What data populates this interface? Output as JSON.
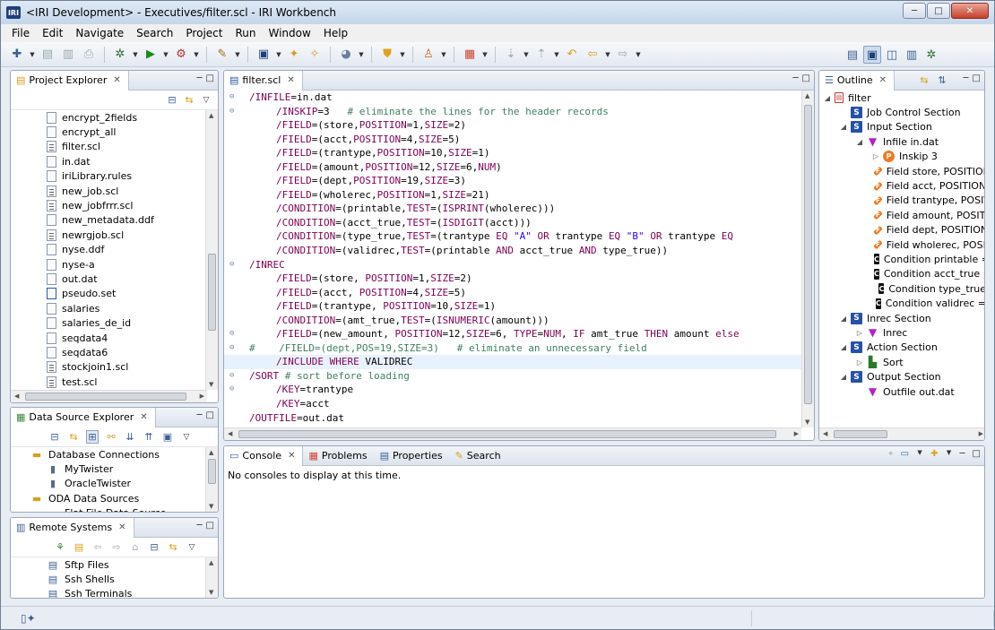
{
  "window": {
    "title": "<IRI Development> - Executives/filter.scl - IRI Workbench",
    "app_icon_text": "IRI",
    "buttons": [
      "─",
      "□",
      "✕"
    ]
  },
  "menu": [
    "File",
    "Edit",
    "Navigate",
    "Search",
    "Project",
    "Run",
    "Window",
    "Help"
  ],
  "project_explorer": {
    "title": "Project Explorer",
    "files": [
      {
        "name": "encrypt_2fields",
        "icon": "file-icon"
      },
      {
        "name": "encrypt_all",
        "icon": "file-icon"
      },
      {
        "name": "filter.scl",
        "icon": "scl-file-icon"
      },
      {
        "name": "in.dat",
        "icon": "file-icon"
      },
      {
        "name": "iriLibrary.rules",
        "icon": "file-icon"
      },
      {
        "name": "new_job.scl",
        "icon": "scl-file-icon"
      },
      {
        "name": "new_jobfrrr.scl",
        "icon": "scl-file-icon"
      },
      {
        "name": "new_metadata.ddf",
        "icon": "ddf-file-icon"
      },
      {
        "name": "newrgjob.scl",
        "icon": "scl-file-icon"
      },
      {
        "name": "nyse.ddf",
        "icon": "ddf-file-icon"
      },
      {
        "name": "nyse-a",
        "icon": "file-icon"
      },
      {
        "name": "out.dat",
        "icon": "file-icon"
      },
      {
        "name": "pseudo.set",
        "icon": "set-file-icon"
      },
      {
        "name": "salaries",
        "icon": "file-icon"
      },
      {
        "name": "salaries_de_id",
        "icon": "file-icon"
      },
      {
        "name": "seqdata4",
        "icon": "file-icon"
      },
      {
        "name": "seqdata6",
        "icon": "file-icon"
      },
      {
        "name": "stockjoin1.scl",
        "icon": "scl-file-icon"
      },
      {
        "name": "test.scl",
        "icon": "scl-file-icon"
      }
    ]
  },
  "data_source_explorer": {
    "title": "Data Source Explorer",
    "items": [
      {
        "label": "Database Connections",
        "level": 0,
        "icon": "folder-icon"
      },
      {
        "label": "MyTwister",
        "level": 1,
        "icon": "database-icon"
      },
      {
        "label": "OracleTwister",
        "level": 1,
        "icon": "database-icon"
      },
      {
        "label": "ODA Data Sources",
        "level": 0,
        "icon": "folder-icon"
      },
      {
        "label": "Flat File Data Source",
        "level": 1,
        "icon": "folder-icon"
      }
    ]
  },
  "remote_systems": {
    "title": "Remote Systems",
    "items": [
      {
        "label": "Sftp Files",
        "icon": "sftp-icon"
      },
      {
        "label": "Ssh Shells",
        "icon": "shell-icon"
      },
      {
        "label": "Ssh Terminals",
        "icon": "terminal-icon"
      }
    ]
  },
  "editor": {
    "tab": "filter.scl",
    "lines": [
      {
        "fold": "⊖",
        "indent": 0,
        "parts": [
          [
            "k",
            "/INFILE"
          ],
          [
            "v",
            "=in.dat"
          ]
        ]
      },
      {
        "fold": "⊖",
        "indent": 1,
        "parts": [
          [
            "k",
            "/INSKIP"
          ],
          [
            "v",
            "=3   "
          ],
          [
            "c",
            "# eliminate the lines for the header records"
          ]
        ]
      },
      {
        "fold": "",
        "indent": 1,
        "parts": [
          [
            "k",
            "/FIELD"
          ],
          [
            "v",
            "=(store,"
          ],
          [
            "n",
            "POSITION"
          ],
          [
            "v",
            "=1,"
          ],
          [
            "n",
            "SIZE"
          ],
          [
            "v",
            "=2)"
          ]
        ]
      },
      {
        "fold": "",
        "indent": 1,
        "parts": [
          [
            "k",
            "/FIELD"
          ],
          [
            "v",
            "=(acct,"
          ],
          [
            "n",
            "POSITION"
          ],
          [
            "v",
            "=4,"
          ],
          [
            "n",
            "SIZE"
          ],
          [
            "v",
            "=5)"
          ]
        ]
      },
      {
        "fold": "",
        "indent": 1,
        "parts": [
          [
            "k",
            "/FIELD"
          ],
          [
            "v",
            "=(trantype,"
          ],
          [
            "n",
            "POSITION"
          ],
          [
            "v",
            "=10,"
          ],
          [
            "n",
            "SIZE"
          ],
          [
            "v",
            "=1)"
          ]
        ]
      },
      {
        "fold": "",
        "indent": 1,
        "parts": [
          [
            "k",
            "/FIELD"
          ],
          [
            "v",
            "=(amount,"
          ],
          [
            "n",
            "POSITION"
          ],
          [
            "v",
            "=12,"
          ],
          [
            "n",
            "SIZE"
          ],
          [
            "v",
            "=6,"
          ],
          [
            "n",
            "NUM"
          ],
          [
            "v",
            ")"
          ]
        ]
      },
      {
        "fold": "",
        "indent": 1,
        "parts": [
          [
            "k",
            "/FIELD"
          ],
          [
            "v",
            "=(dept,"
          ],
          [
            "n",
            "POSITION"
          ],
          [
            "v",
            "=19,"
          ],
          [
            "n",
            "SIZE"
          ],
          [
            "v",
            "=3)"
          ]
        ]
      },
      {
        "fold": "",
        "indent": 1,
        "parts": [
          [
            "k",
            "/FIELD"
          ],
          [
            "v",
            "=(wholerec,"
          ],
          [
            "n",
            "POSITION"
          ],
          [
            "v",
            "=1,"
          ],
          [
            "n",
            "SIZE"
          ],
          [
            "v",
            "=21)"
          ]
        ]
      },
      {
        "fold": "",
        "indent": 1,
        "parts": [
          [
            "k",
            "/CONDITION"
          ],
          [
            "v",
            "=(printable,"
          ],
          [
            "n",
            "TEST"
          ],
          [
            "v",
            "=("
          ],
          [
            "n",
            "ISPRINT"
          ],
          [
            "v",
            "(wholerec)))"
          ]
        ]
      },
      {
        "fold": "",
        "indent": 1,
        "parts": [
          [
            "k",
            "/CONDITION"
          ],
          [
            "v",
            "=(acct_true,"
          ],
          [
            "n",
            "TEST"
          ],
          [
            "v",
            "=("
          ],
          [
            "n",
            "ISDIGIT"
          ],
          [
            "v",
            "(acct)))"
          ]
        ]
      },
      {
        "fold": "",
        "indent": 1,
        "parts": [
          [
            "k",
            "/CONDITION"
          ],
          [
            "v",
            "=(type_true,"
          ],
          [
            "n",
            "TEST"
          ],
          [
            "v",
            "=(trantype "
          ],
          [
            "n",
            "EQ"
          ],
          [
            "s",
            " \"A\" "
          ],
          [
            "n",
            "OR"
          ],
          [
            "v",
            " trantype "
          ],
          [
            "n",
            "EQ"
          ],
          [
            "s",
            " \"B\" "
          ],
          [
            "n",
            "OR"
          ],
          [
            "v",
            " trantype "
          ],
          [
            "n",
            "EQ"
          ]
        ]
      },
      {
        "fold": "",
        "indent": 1,
        "parts": [
          [
            "k",
            "/CONDITION"
          ],
          [
            "v",
            "=(validrec,"
          ],
          [
            "n",
            "TEST"
          ],
          [
            "v",
            "=(printable "
          ],
          [
            "n",
            "AND"
          ],
          [
            "v",
            " acct_true "
          ],
          [
            "n",
            "AND"
          ],
          [
            "v",
            " type_true))"
          ]
        ]
      },
      {
        "fold": "⊖",
        "indent": 0,
        "parts": [
          [
            "k",
            "/INREC"
          ]
        ]
      },
      {
        "fold": "",
        "indent": 1,
        "parts": [
          [
            "k",
            "/FIELD"
          ],
          [
            "v",
            "=(store, "
          ],
          [
            "n",
            "POSITION"
          ],
          [
            "v",
            "=1,"
          ],
          [
            "n",
            "SIZE"
          ],
          [
            "v",
            "=2)"
          ]
        ]
      },
      {
        "fold": "",
        "indent": 1,
        "parts": [
          [
            "k",
            "/FIELD"
          ],
          [
            "v",
            "=(acct, "
          ],
          [
            "n",
            "POSITION"
          ],
          [
            "v",
            "=4,"
          ],
          [
            "n",
            "SIZE"
          ],
          [
            "v",
            "=5)"
          ]
        ]
      },
      {
        "fold": "",
        "indent": 1,
        "parts": [
          [
            "k",
            "/FIELD"
          ],
          [
            "v",
            "=(trantype, "
          ],
          [
            "n",
            "POSITION"
          ],
          [
            "v",
            "=10,"
          ],
          [
            "n",
            "SIZE"
          ],
          [
            "v",
            "=1)"
          ]
        ]
      },
      {
        "fold": "",
        "indent": 1,
        "parts": [
          [
            "k",
            "/CONDITION"
          ],
          [
            "v",
            "=(amt_true,"
          ],
          [
            "n",
            "TEST"
          ],
          [
            "v",
            "=("
          ],
          [
            "n",
            "ISNUMERIC"
          ],
          [
            "v",
            "(amount)))"
          ]
        ]
      },
      {
        "fold": "⊖",
        "indent": 1,
        "parts": [
          [
            "k",
            "/FIELD"
          ],
          [
            "v",
            "=(new_amount, "
          ],
          [
            "n",
            "POSITION"
          ],
          [
            "v",
            "=12,"
          ],
          [
            "n",
            "SIZE"
          ],
          [
            "v",
            "=6, "
          ],
          [
            "n",
            "TYPE"
          ],
          [
            "v",
            "="
          ],
          [
            "n",
            "NUM"
          ],
          [
            "v",
            ", "
          ],
          [
            "n",
            "IF"
          ],
          [
            "v",
            " amt_true "
          ],
          [
            "n",
            "THEN"
          ],
          [
            "v",
            " amount "
          ],
          [
            "n",
            "else"
          ]
        ]
      },
      {
        "fold": "⊖",
        "indent": 0,
        "parts": [
          [
            "c",
            "#    /FIELD=(dept,POS=19,SIZE=3)   # eliminate an unnecessary field"
          ]
        ]
      },
      {
        "fold": "",
        "indent": 1,
        "highlight": true,
        "parts": [
          [
            "k",
            "/INCLUDE"
          ],
          [
            "v",
            " "
          ],
          [
            "n",
            "WHERE"
          ],
          [
            "v",
            " VALIDREC"
          ]
        ]
      },
      {
        "fold": "⊖",
        "indent": 0,
        "parts": [
          [
            "k",
            "/SORT"
          ],
          [
            "v",
            " "
          ],
          [
            "c",
            "# sort before loading"
          ]
        ]
      },
      {
        "fold": "⊖",
        "indent": 1,
        "parts": [
          [
            "k",
            "/KEY"
          ],
          [
            "v",
            "=trantype"
          ]
        ]
      },
      {
        "fold": "",
        "indent": 1,
        "parts": [
          [
            "k",
            "/KEY"
          ],
          [
            "v",
            "=acct"
          ]
        ]
      },
      {
        "fold": "",
        "indent": 0,
        "parts": [
          [
            "k",
            "/OUTFILE"
          ],
          [
            "v",
            "=out.dat"
          ]
        ]
      }
    ]
  },
  "outline": {
    "title": "Outline",
    "items": [
      {
        "label": "filter",
        "level": 0,
        "twisty": "◢",
        "badge": "file"
      },
      {
        "label": "Job Control Section",
        "level": 1,
        "twisty": "",
        "badge": "s"
      },
      {
        "label": "Input Section",
        "level": 1,
        "twisty": "◢",
        "badge": "s"
      },
      {
        "label": "Infile in.dat",
        "level": 2,
        "twisty": "◢",
        "badge": "v"
      },
      {
        "label": "Inskip 3",
        "level": 3,
        "twisty": "▷",
        "badge": "p"
      },
      {
        "label": "Field store, POSITION",
        "level": 3,
        "twisty": "",
        "badge": "f"
      },
      {
        "label": "Field acct, POSITION",
        "level": 3,
        "twisty": "",
        "badge": "f"
      },
      {
        "label": "Field trantype, POSIT",
        "level": 3,
        "twisty": "",
        "badge": "f"
      },
      {
        "label": "Field amount, POSIT.",
        "level": 3,
        "twisty": "",
        "badge": "f"
      },
      {
        "label": "Field dept, POSITION",
        "level": 3,
        "twisty": "",
        "badge": "f"
      },
      {
        "label": "Field wholerec, POSIT",
        "level": 3,
        "twisty": "",
        "badge": "f"
      },
      {
        "label": "Condition printable =",
        "level": 3,
        "twisty": "",
        "badge": "c"
      },
      {
        "label": "Condition acct_true =",
        "level": 3,
        "twisty": "",
        "badge": "c"
      },
      {
        "label": "Condition type_true",
        "level": 3,
        "twisty": "",
        "badge": "c"
      },
      {
        "label": "Condition validrec =",
        "level": 3,
        "twisty": "",
        "badge": "c"
      },
      {
        "label": "Inrec Section",
        "level": 1,
        "twisty": "◢",
        "badge": "s"
      },
      {
        "label": "Inrec",
        "level": 2,
        "twisty": "▷",
        "badge": "v"
      },
      {
        "label": "Action Section",
        "level": 1,
        "twisty": "◢",
        "badge": "s"
      },
      {
        "label": "Sort",
        "level": 2,
        "twisty": "▷",
        "badge": "sort"
      },
      {
        "label": "Output Section",
        "level": 1,
        "twisty": "◢",
        "badge": "s"
      },
      {
        "label": "Outfile out.dat",
        "level": 2,
        "twisty": "",
        "badge": "v"
      }
    ]
  },
  "console": {
    "tabs": [
      "Console",
      "Problems",
      "Properties",
      "Search"
    ],
    "message": "No consoles to display at this time."
  },
  "icons": {
    "close": "✕",
    "minimize": "─",
    "maximize": "□",
    "menu_arrow": "▽",
    "collapse": "⊟",
    "link": "⇆"
  }
}
